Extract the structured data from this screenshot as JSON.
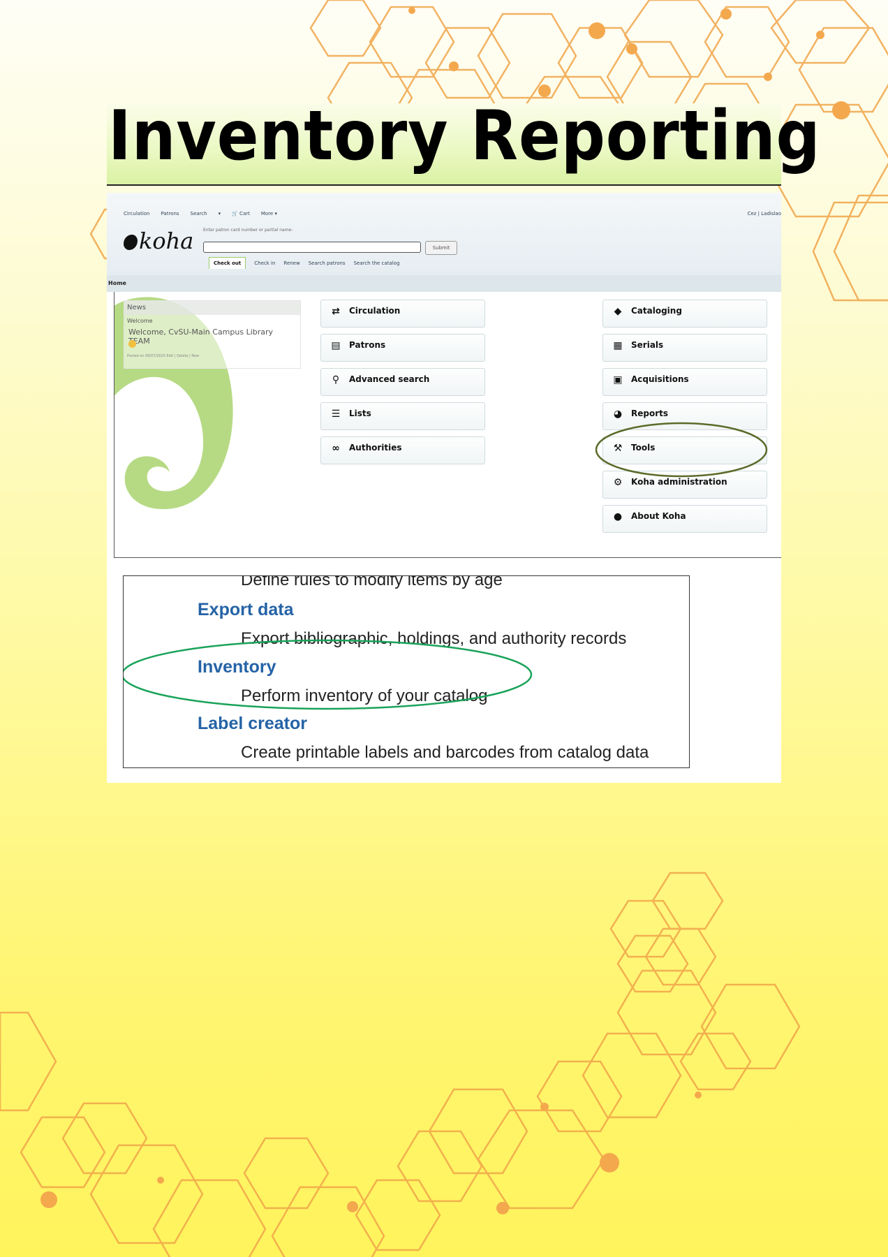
{
  "slide": {
    "title": "Inventory Reporting"
  },
  "koha": {
    "topnav": [
      "Circulation",
      "Patrons",
      "Search",
      "▾",
      "🛒 Cart",
      "More ▾"
    ],
    "user": "Cez | Ladislao",
    "logo_text": "koha",
    "patron_label": "Enter patron card number or partial name:",
    "submit_label": "Submit",
    "circ_tabs": [
      "Check out",
      "Check in",
      "Renew",
      "Search patrons",
      "Search the catalog"
    ],
    "breadcrumb": "Home",
    "news": {
      "heading": "News",
      "title": "Welcome",
      "message": "Welcome, CvSU-Main Campus Library TEAM",
      "posted": "Posted on 09/07/2020 Edit | Delete | New"
    },
    "left_menu": [
      {
        "label": "Circulation",
        "icon": "arrows-icon"
      },
      {
        "label": "Patrons",
        "icon": "id-card-icon"
      },
      {
        "label": "Advanced search",
        "icon": "search-icon"
      },
      {
        "label": "Lists",
        "icon": "list-icon"
      },
      {
        "label": "Authorities",
        "icon": "link-icon"
      }
    ],
    "right_menu": [
      {
        "label": "Cataloging",
        "icon": "tag-icon"
      },
      {
        "label": "Serials",
        "icon": "newspaper-icon"
      },
      {
        "label": "Acquisitions",
        "icon": "gift-icon"
      },
      {
        "label": "Reports",
        "icon": "pie-chart-icon"
      },
      {
        "label": "Tools",
        "icon": "wrench-icon"
      },
      {
        "label": "Koha administration",
        "icon": "gears-icon"
      },
      {
        "label": "About Koha",
        "icon": "koha-leaf-icon"
      }
    ]
  },
  "tools_list": {
    "partial_top": "Define rules to modify items by age",
    "items": [
      {
        "name": "Export data",
        "description": "Export bibliographic, holdings, and authority records"
      },
      {
        "name": "Inventory",
        "description": "Perform inventory of your catalog"
      },
      {
        "name": "Label creator",
        "description": "Create printable labels and barcodes from catalog data"
      }
    ]
  },
  "colors": {
    "highlight_tools": "#5b6b2a",
    "highlight_inventory": "#1aa35a",
    "link_blue": "#2563a6",
    "decor_orange": "#f0a040"
  }
}
